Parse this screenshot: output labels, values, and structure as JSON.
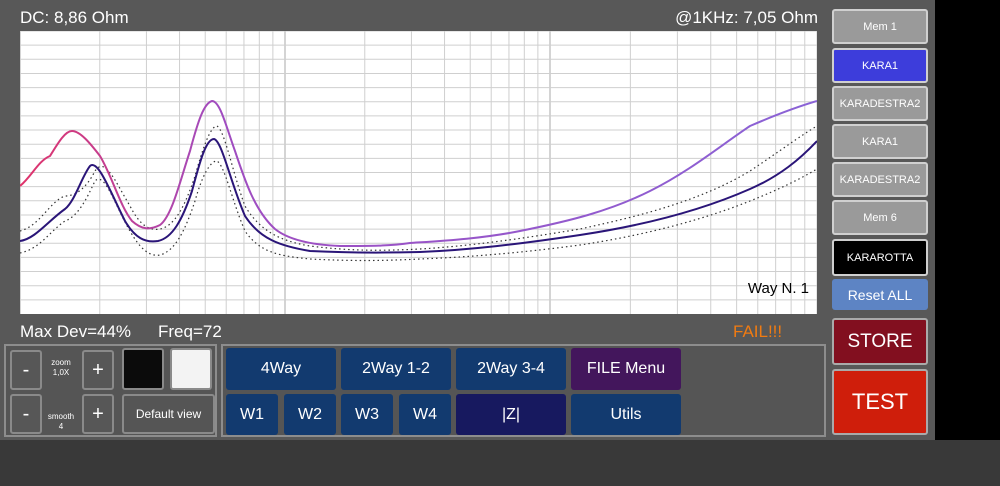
{
  "header": {
    "dc_label": "DC: 8,86 Ohm",
    "khz_label": "@1KHz: 7,05 Ohm"
  },
  "plot": {
    "way_label": "Way N. 1"
  },
  "status": {
    "max_dev": "Max Dev=44%",
    "freq": "Freq=72",
    "result": "FAIL!!!"
  },
  "memories": [
    {
      "label": "Mem 1"
    },
    {
      "label": "KARA1"
    },
    {
      "label": "KARADESTRA2"
    },
    {
      "label": "KARA1"
    },
    {
      "label": "KARADESTRA2"
    },
    {
      "label": "Mem 6"
    },
    {
      "label": "KARAROTTA"
    }
  ],
  "actions": {
    "reset_all": "Reset ALL",
    "store": "STORE",
    "test": "TEST"
  },
  "zoom": {
    "minus": "-",
    "plus": "+",
    "zoom_label": "zoom",
    "zoom_value": "1,0X",
    "smooth_label": "smooth",
    "smooth_value": "4",
    "default_view": "Default view",
    "black_color": "#0b0b0b",
    "white_color": "#f3f3f3"
  },
  "buttons": {
    "way4": "4Way",
    "way2_12": "2Way 1-2",
    "way2_34": "2Way 3-4",
    "file_menu": "FILE Menu",
    "w1": "W1",
    "w2": "W2",
    "w3": "W3",
    "w4": "W4",
    "z": "|Z|",
    "utils": "Utils"
  },
  "colors": {
    "measured_start": "#e0336a",
    "measured_end": "#8a63d6",
    "reference": "#2a1578",
    "tolerance": "#333333",
    "fail": "#f07b12",
    "active_mem": "#3d3ddb"
  }
}
